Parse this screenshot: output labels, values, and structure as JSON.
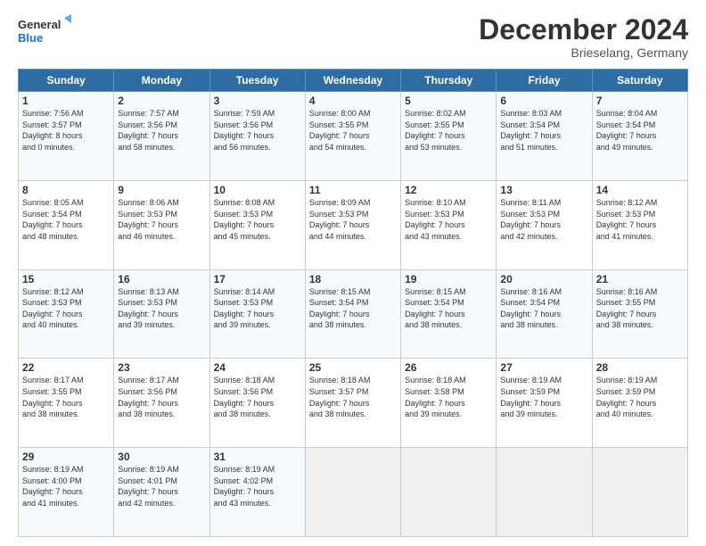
{
  "header": {
    "logo_line1": "General",
    "logo_line2": "Blue",
    "title": "December 2024",
    "subtitle": "Brieselang, Germany"
  },
  "weekdays": [
    "Sunday",
    "Monday",
    "Tuesday",
    "Wednesday",
    "Thursday",
    "Friday",
    "Saturday"
  ],
  "weeks": [
    [
      {
        "day": "1",
        "detail": "Sunrise: 7:56 AM\nSunset: 3:57 PM\nDaylight: 8 hours\nand 0 minutes."
      },
      {
        "day": "2",
        "detail": "Sunrise: 7:57 AM\nSunset: 3:56 PM\nDaylight: 7 hours\nand 58 minutes."
      },
      {
        "day": "3",
        "detail": "Sunrise: 7:59 AM\nSunset: 3:56 PM\nDaylight: 7 hours\nand 56 minutes."
      },
      {
        "day": "4",
        "detail": "Sunrise: 8:00 AM\nSunset: 3:55 PM\nDaylight: 7 hours\nand 54 minutes."
      },
      {
        "day": "5",
        "detail": "Sunrise: 8:02 AM\nSunset: 3:55 PM\nDaylight: 7 hours\nand 53 minutes."
      },
      {
        "day": "6",
        "detail": "Sunrise: 8:03 AM\nSunset: 3:54 PM\nDaylight: 7 hours\nand 51 minutes."
      },
      {
        "day": "7",
        "detail": "Sunrise: 8:04 AM\nSunset: 3:54 PM\nDaylight: 7 hours\nand 49 minutes."
      }
    ],
    [
      {
        "day": "8",
        "detail": "Sunrise: 8:05 AM\nSunset: 3:54 PM\nDaylight: 7 hours\nand 48 minutes."
      },
      {
        "day": "9",
        "detail": "Sunrise: 8:06 AM\nSunset: 3:53 PM\nDaylight: 7 hours\nand 46 minutes."
      },
      {
        "day": "10",
        "detail": "Sunrise: 8:08 AM\nSunset: 3:53 PM\nDaylight: 7 hours\nand 45 minutes."
      },
      {
        "day": "11",
        "detail": "Sunrise: 8:09 AM\nSunset: 3:53 PM\nDaylight: 7 hours\nand 44 minutes."
      },
      {
        "day": "12",
        "detail": "Sunrise: 8:10 AM\nSunset: 3:53 PM\nDaylight: 7 hours\nand 43 minutes."
      },
      {
        "day": "13",
        "detail": "Sunrise: 8:11 AM\nSunset: 3:53 PM\nDaylight: 7 hours\nand 42 minutes."
      },
      {
        "day": "14",
        "detail": "Sunrise: 8:12 AM\nSunset: 3:53 PM\nDaylight: 7 hours\nand 41 minutes."
      }
    ],
    [
      {
        "day": "15",
        "detail": "Sunrise: 8:12 AM\nSunset: 3:53 PM\nDaylight: 7 hours\nand 40 minutes."
      },
      {
        "day": "16",
        "detail": "Sunrise: 8:13 AM\nSunset: 3:53 PM\nDaylight: 7 hours\nand 39 minutes."
      },
      {
        "day": "17",
        "detail": "Sunrise: 8:14 AM\nSunset: 3:53 PM\nDaylight: 7 hours\nand 39 minutes."
      },
      {
        "day": "18",
        "detail": "Sunrise: 8:15 AM\nSunset: 3:54 PM\nDaylight: 7 hours\nand 38 minutes."
      },
      {
        "day": "19",
        "detail": "Sunrise: 8:15 AM\nSunset: 3:54 PM\nDaylight: 7 hours\nand 38 minutes."
      },
      {
        "day": "20",
        "detail": "Sunrise: 8:16 AM\nSunset: 3:54 PM\nDaylight: 7 hours\nand 38 minutes."
      },
      {
        "day": "21",
        "detail": "Sunrise: 8:16 AM\nSunset: 3:55 PM\nDaylight: 7 hours\nand 38 minutes."
      }
    ],
    [
      {
        "day": "22",
        "detail": "Sunrise: 8:17 AM\nSunset: 3:55 PM\nDaylight: 7 hours\nand 38 minutes."
      },
      {
        "day": "23",
        "detail": "Sunrise: 8:17 AM\nSunset: 3:56 PM\nDaylight: 7 hours\nand 38 minutes."
      },
      {
        "day": "24",
        "detail": "Sunrise: 8:18 AM\nSunset: 3:56 PM\nDaylight: 7 hours\nand 38 minutes."
      },
      {
        "day": "25",
        "detail": "Sunrise: 8:18 AM\nSunset: 3:57 PM\nDaylight: 7 hours\nand 38 minutes."
      },
      {
        "day": "26",
        "detail": "Sunrise: 8:18 AM\nSunset: 3:58 PM\nDaylight: 7 hours\nand 39 minutes."
      },
      {
        "day": "27",
        "detail": "Sunrise: 8:19 AM\nSunset: 3:59 PM\nDaylight: 7 hours\nand 39 minutes."
      },
      {
        "day": "28",
        "detail": "Sunrise: 8:19 AM\nSunset: 3:59 PM\nDaylight: 7 hours\nand 40 minutes."
      }
    ],
    [
      {
        "day": "29",
        "detail": "Sunrise: 8:19 AM\nSunset: 4:00 PM\nDaylight: 7 hours\nand 41 minutes."
      },
      {
        "day": "30",
        "detail": "Sunrise: 8:19 AM\nSunset: 4:01 PM\nDaylight: 7 hours\nand 42 minutes."
      },
      {
        "day": "31",
        "detail": "Sunrise: 8:19 AM\nSunset: 4:02 PM\nDaylight: 7 hours\nand 43 minutes."
      },
      {
        "day": "",
        "detail": ""
      },
      {
        "day": "",
        "detail": ""
      },
      {
        "day": "",
        "detail": ""
      },
      {
        "day": "",
        "detail": ""
      }
    ]
  ]
}
